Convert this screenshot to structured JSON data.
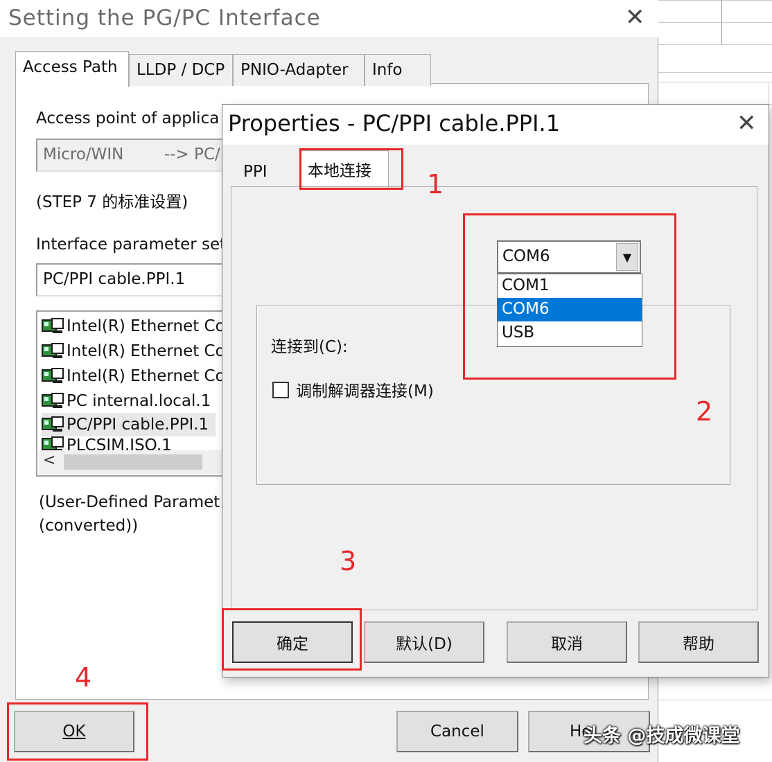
{
  "main_dialog": {
    "title": "Setting the PG/PC Interface",
    "tabs": [
      {
        "label": "Access Path",
        "active": true
      },
      {
        "label": "LLDP / DCP",
        "active": false
      },
      {
        "label": "PNIO-Adapter",
        "active": false
      },
      {
        "label": "Info",
        "active": false
      }
    ],
    "access_point_label": "Access point of applica",
    "access_point_value": "Micro/WIN        --> PC/",
    "standard_setting_note": "(STEP 7 的标准设置)",
    "interface_param_label": "Interface parameter set",
    "interface_param_value": "PC/PPI cable.PPI.1",
    "interface_list": [
      "Intel(R) Ethernet Co",
      "Intel(R) Ethernet Co",
      "Intel(R) Ethernet Co",
      "PC internal.local.1",
      "PC/PPI cable.PPI.1",
      "PLCSIM.ISO.1"
    ],
    "interface_list_selected": "PC/PPI cable.PPI.1",
    "scroll_left": "<",
    "param_note_line1": "(User-Defined Paramet",
    "param_note_line2": "(converted))",
    "ok_label": "OK",
    "cancel_label": "Cancel",
    "help_label": "He"
  },
  "properties_dialog": {
    "title": "Properties - PC/PPI cable.PPI.1",
    "tabs": [
      {
        "label": "PPI",
        "active": false
      },
      {
        "label": "本地连接",
        "active": true
      }
    ],
    "connect_to_label": "连接到(C):",
    "modem_checkbox_label": "调制解调器连接(M)",
    "modem_checked": false,
    "port_selected": "COM6",
    "port_options": [
      "COM1",
      "COM6",
      "USB"
    ],
    "buttons": {
      "ok": "确定",
      "default": "默认(D)",
      "cancel": "取消",
      "help": "帮助"
    }
  },
  "annotations": [
    "1",
    "2",
    "3",
    "4"
  ],
  "watermark": "头条 @技成微课堂",
  "colors": {
    "annotation_red": "#e8272b",
    "selection_blue": "#0078d7",
    "dialog_bg": "#f0f0f0"
  }
}
